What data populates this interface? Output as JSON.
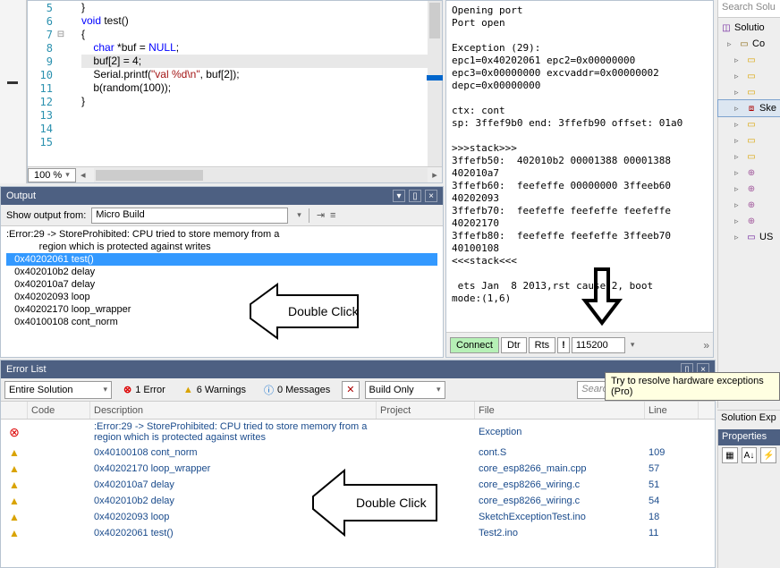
{
  "editor": {
    "zoom": "100 %",
    "lines": [
      {
        "n": 5,
        "fold": "",
        "html": "}"
      },
      {
        "n": 6,
        "fold": "",
        "html": ""
      },
      {
        "n": 7,
        "fold": "⊟",
        "html": "<span class='kw'>void</span> test()"
      },
      {
        "n": 8,
        "fold": "",
        "html": "{"
      },
      {
        "n": 9,
        "fold": "",
        "html": ""
      },
      {
        "n": 10,
        "fold": "",
        "html": "    <span class='kw'>char</span> *buf = <span class='kw'>NULL</span>;"
      },
      {
        "n": 11,
        "fold": "",
        "html": "    buf[2] = 4;",
        "hl": true
      },
      {
        "n": 12,
        "fold": "",
        "html": "    Serial.printf(<span class='str'>\"val %d\\n\"</span>, buf[2]);"
      },
      {
        "n": 13,
        "fold": "",
        "html": "    b(random(100));"
      },
      {
        "n": 14,
        "fold": "",
        "html": "}"
      },
      {
        "n": 15,
        "fold": "",
        "html": ""
      }
    ]
  },
  "terminal": {
    "text": "Opening port\nPort open\n\nException (29):\nepc1=0x40202061 epc2=0x00000000\nepc3=0x00000000 excvaddr=0x00000002\ndepc=0x00000000\n\nctx: cont\nsp: 3ffef9b0 end: 3ffefb90 offset: 01a0\n\n>>>stack>>>\n3ffefb50:  402010b2 00001388 00001388\n402010a7\n3ffefb60:  feefeffe 00000000 3ffeeb60\n40202093\n3ffefb70:  feefeffe feefeffe feefeffe\n40202170\n3ffefb80:  feefeffe feefeffe 3ffeeb70\n40100108\n<<<stack<<<\n\n ets Jan  8 2013,rst cause:2, boot\nmode:(1,6)",
    "connect": "Connect",
    "dtr": "Dtr",
    "rts": "Rts",
    "baud": "115200"
  },
  "solution": {
    "search": "Search Solu",
    "root": "Solutio",
    "items": [
      "Co",
      "",
      "",
      "",
      "Ske",
      "",
      "",
      "",
      "",
      "",
      "",
      "",
      "US"
    ],
    "explorer_title": "Solution Exp"
  },
  "output": {
    "title": "Output",
    "from_label": "Show output from:",
    "from_value": "Micro Build",
    "lines": [
      ":Error:29 -> StoreProhibited: CPU tried to store memory from a",
      "            region which is protected against writes",
      "   0x40202061 test()",
      "   0x402010b2 delay",
      "   0x402010a7 delay",
      "   0x40202093 loop",
      "   0x40202170 loop_wrapper",
      "   0x40100108 cont_norm"
    ],
    "sel_index": 2,
    "callout": "Double Click"
  },
  "errorlist": {
    "title": "Error List",
    "scope": "Entire Solution",
    "err_count": "1 Error",
    "warn_count": "6 Warnings",
    "msg_count": "0 Messages",
    "build": "Build Only",
    "search_placeholder": "Search Error List",
    "tooltip": "Try to resolve hardware exceptions (Pro)",
    "cols": [
      "",
      "Code",
      "Description",
      "Project",
      "File",
      "Line"
    ],
    "rows": [
      {
        "t": "e",
        "code": "",
        "desc": ":Error:29 -> StoreProhibited: CPU tried to store memory from a region which is protected against writes",
        "proj": "",
        "file": "Exception",
        "line": ""
      },
      {
        "t": "w",
        "code": "",
        "desc": "0x40100108 cont_norm",
        "proj": "",
        "file": "cont.S",
        "line": "109"
      },
      {
        "t": "w",
        "code": "",
        "desc": "0x40202170 loop_wrapper",
        "proj": "",
        "file": "core_esp8266_main.cpp",
        "line": "57"
      },
      {
        "t": "w",
        "code": "",
        "desc": "0x402010a7 delay",
        "proj": "",
        "file": "core_esp8266_wiring.c",
        "line": "51"
      },
      {
        "t": "w",
        "code": "",
        "desc": "0x402010b2 delay",
        "proj": "",
        "file": "core_esp8266_wiring.c",
        "line": "54"
      },
      {
        "t": "w",
        "code": "",
        "desc": "0x40202093 loop",
        "proj": "",
        "file": "SketchExceptionTest.ino",
        "line": "18"
      },
      {
        "t": "w",
        "code": "",
        "desc": "0x40202061 test()",
        "proj": "",
        "file": "Test2.ino",
        "line": "11"
      }
    ],
    "callout": "Double Click"
  },
  "properties": {
    "title": "Properties"
  }
}
